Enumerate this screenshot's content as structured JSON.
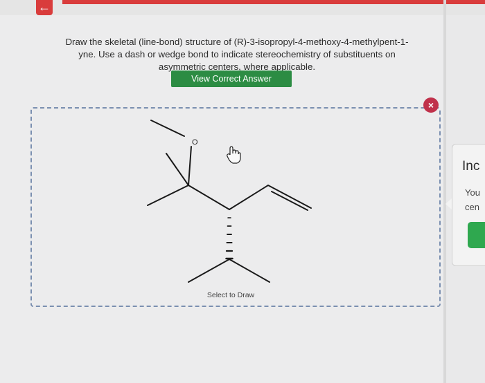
{
  "nav": {
    "back_glyph": "←"
  },
  "question": {
    "line1": "Draw the skeletal (line-bond) structure of (R)-3-isopropyl-4-methoxy-4-methylpent-1-",
    "line2": "yne. Use a dash or wedge bond to indicate stereochemistry of substituents on",
    "line3": "asymmetric centers, where applicable."
  },
  "answer_button": {
    "label": "View Correct Answer"
  },
  "canvas": {
    "close_glyph": "×",
    "oxygen_label": "O",
    "select_label": "Select to Draw"
  },
  "side_panel": {
    "title": "Inc",
    "line1": "You",
    "line2": "cen"
  },
  "colors": {
    "accent_green": "#2c8c43",
    "close_red": "#c0314b",
    "dash_border": "#7a8fb0",
    "top_red": "#d93c3c"
  }
}
